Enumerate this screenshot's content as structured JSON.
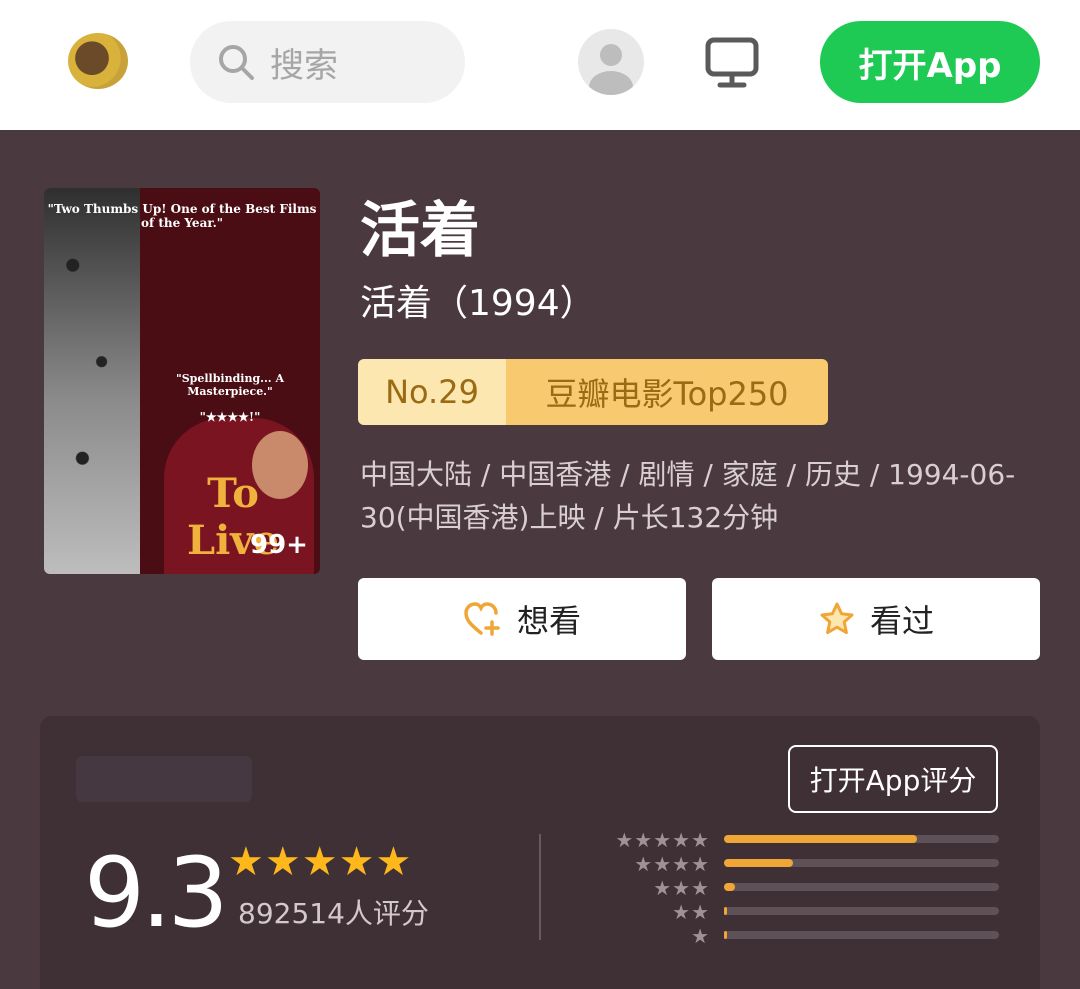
{
  "topbar": {
    "search_placeholder": "搜索",
    "open_app_label": "打开App"
  },
  "poster": {
    "quote_top": "\"Two Thumbs Up! One of the Best Films of the Year.\"",
    "quote_mid": "\"Spellbinding... A Masterpiece.\"",
    "stars": "\"★★★★!\"",
    "title": "To Live",
    "badge": "99+"
  },
  "movie": {
    "title": "活着",
    "subtitle": "活着（1994）",
    "rank_no": "No.29",
    "rank_list": "豆瓣电影Top250",
    "meta": "中国大陆 / 中国香港 / 剧情 / 家庭 / 历史 / 1994-06-30(中国香港)上映 / 片长132分钟"
  },
  "actions": {
    "want_label": "想看",
    "watched_label": "看过"
  },
  "rating": {
    "open_app_rate_label": "打开App评分",
    "score": "9.3",
    "stars": "★★★★★",
    "count": "892514人评分",
    "distribution": [
      {
        "stars": "★★★★★",
        "fraction": 0.7
      },
      {
        "stars": "★★★★",
        "fraction": 0.25
      },
      {
        "stars": "★★★",
        "fraction": 0.04
      },
      {
        "stars": "★★",
        "fraction": 0.005
      },
      {
        "stars": "★",
        "fraction": 0.005
      }
    ]
  },
  "colors": {
    "bg": "#4a393f",
    "green": "#1ec954",
    "gold": "#f0a636"
  }
}
